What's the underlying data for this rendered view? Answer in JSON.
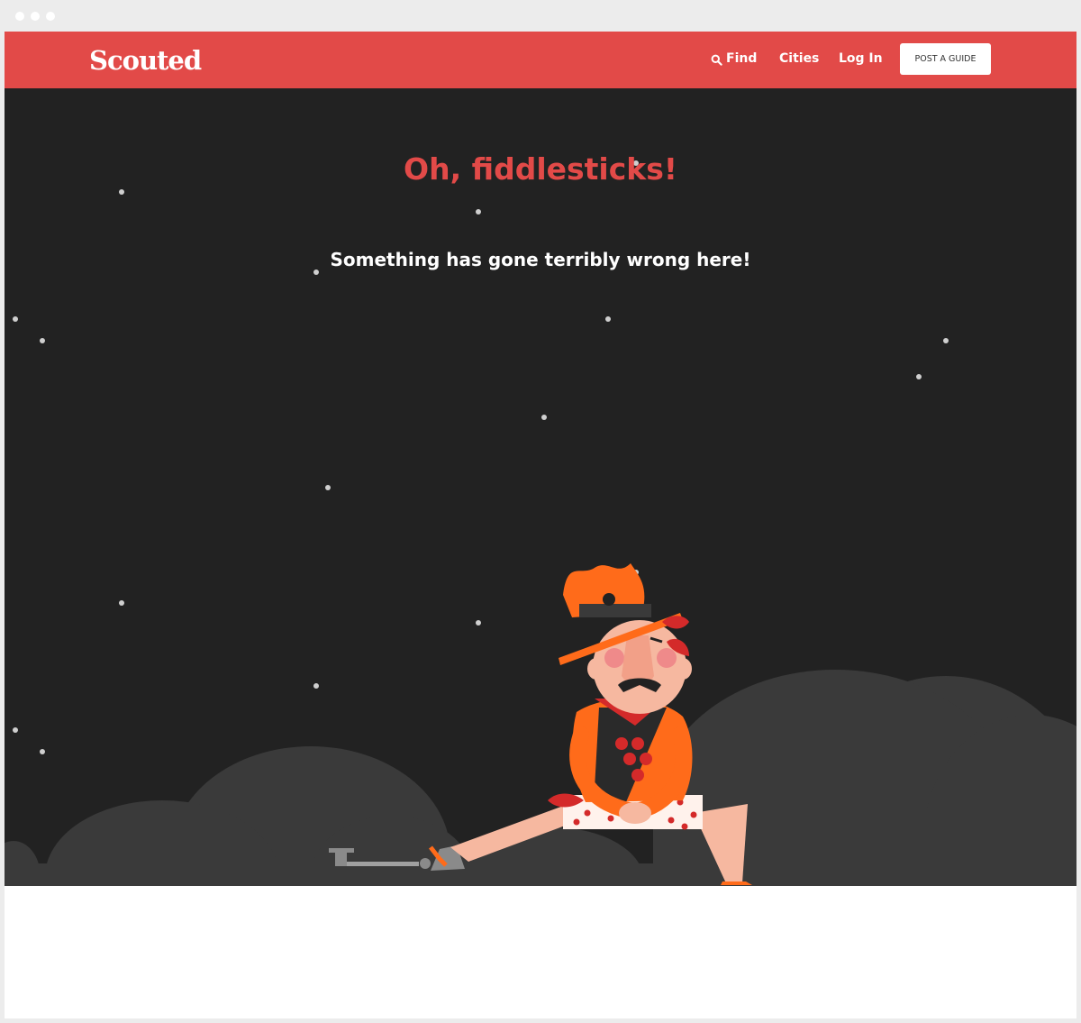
{
  "window": {
    "controls": [
      "dot",
      "dot",
      "dot"
    ]
  },
  "navbar": {
    "logo": "Scouted",
    "links": [
      {
        "label": "Find",
        "icon": "search-icon"
      },
      {
        "label": "Cities"
      },
      {
        "label": "Log In"
      }
    ],
    "cta": "POST A GUIDE"
  },
  "error": {
    "title": "Oh, fiddlesticks!",
    "message": "Something has gone terribly wrong here!"
  },
  "colors": {
    "brand": "#e24a48",
    "scene_bg": "#222222",
    "clouds": "#3a3a3a",
    "scout_orange": "#ff6b1a"
  },
  "illustration": {
    "subject": "scout-character",
    "items": [
      "hat",
      "merit-badges",
      "sash",
      "polka-dot-shorts",
      "ball-and-chain",
      "leaves",
      "clouds",
      "stars"
    ]
  }
}
